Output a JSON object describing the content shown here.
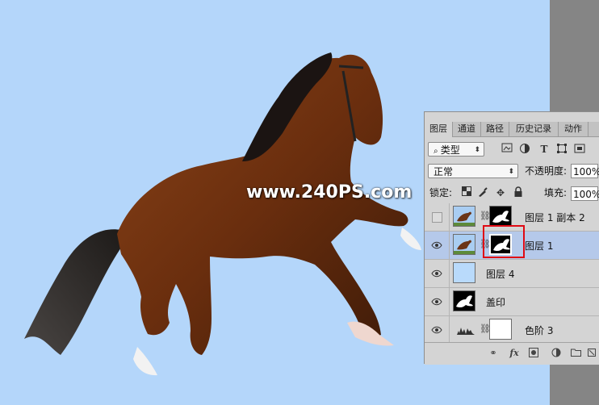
{
  "watermark": {
    "text": "www.240PS.com"
  },
  "panel": {
    "tabs": [
      {
        "label": "图层",
        "active": true
      },
      {
        "label": "通道",
        "active": false
      },
      {
        "label": "路径",
        "active": false
      },
      {
        "label": "历史记录",
        "active": false
      },
      {
        "label": "动作",
        "active": false
      }
    ],
    "filter": {
      "label": "类型",
      "icon": "search-icon"
    },
    "filter_icons": [
      "image-filter-icon",
      "adjustment-filter-icon",
      "type-filter-icon",
      "shape-filter-icon",
      "smart-object-filter-icon"
    ],
    "blend_mode": "正常",
    "opacity": {
      "label": "不透明度:",
      "value": "100%"
    },
    "lock": {
      "label": "锁定:",
      "icons": [
        "lock-transparent-icon",
        "lock-image-icon",
        "lock-position-icon",
        "lock-all-icon"
      ]
    },
    "fill": {
      "label": "填充:",
      "value": "100%"
    },
    "layers": [
      {
        "name": "图层 1 副本 2",
        "visible": false,
        "selected": false,
        "has_mask": true,
        "thumb": "horse-photo",
        "mask": "horse-silhouette"
      },
      {
        "name": "图层 1",
        "visible": true,
        "selected": true,
        "has_mask": true,
        "thumb": "horse-photo",
        "mask": "horse-silhouette"
      },
      {
        "name": "图层 4",
        "visible": true,
        "selected": false,
        "has_mask": false,
        "thumb": "light-blue-fill"
      },
      {
        "name": "盖印",
        "visible": true,
        "selected": false,
        "has_mask": false,
        "thumb": "horse-silhouette"
      },
      {
        "name": "色阶 3",
        "visible": true,
        "selected": false,
        "has_mask": true,
        "thumb": "levels-adjustment",
        "mask": "white-mask"
      }
    ],
    "bottom_icons": [
      "link-layers-icon",
      "fx-icon",
      "add-mask-icon",
      "adjustment-layer-icon",
      "new-group-icon",
      "new-layer-icon",
      "delete-layer-icon"
    ],
    "fx_label": "fx"
  },
  "colors": {
    "canvas_bg": "#b4d6fa",
    "gutter": "#858585",
    "panel_bg": "#d4d4d4",
    "selected_row": "#b5c9ea",
    "highlight_outline": "#e00a14"
  }
}
